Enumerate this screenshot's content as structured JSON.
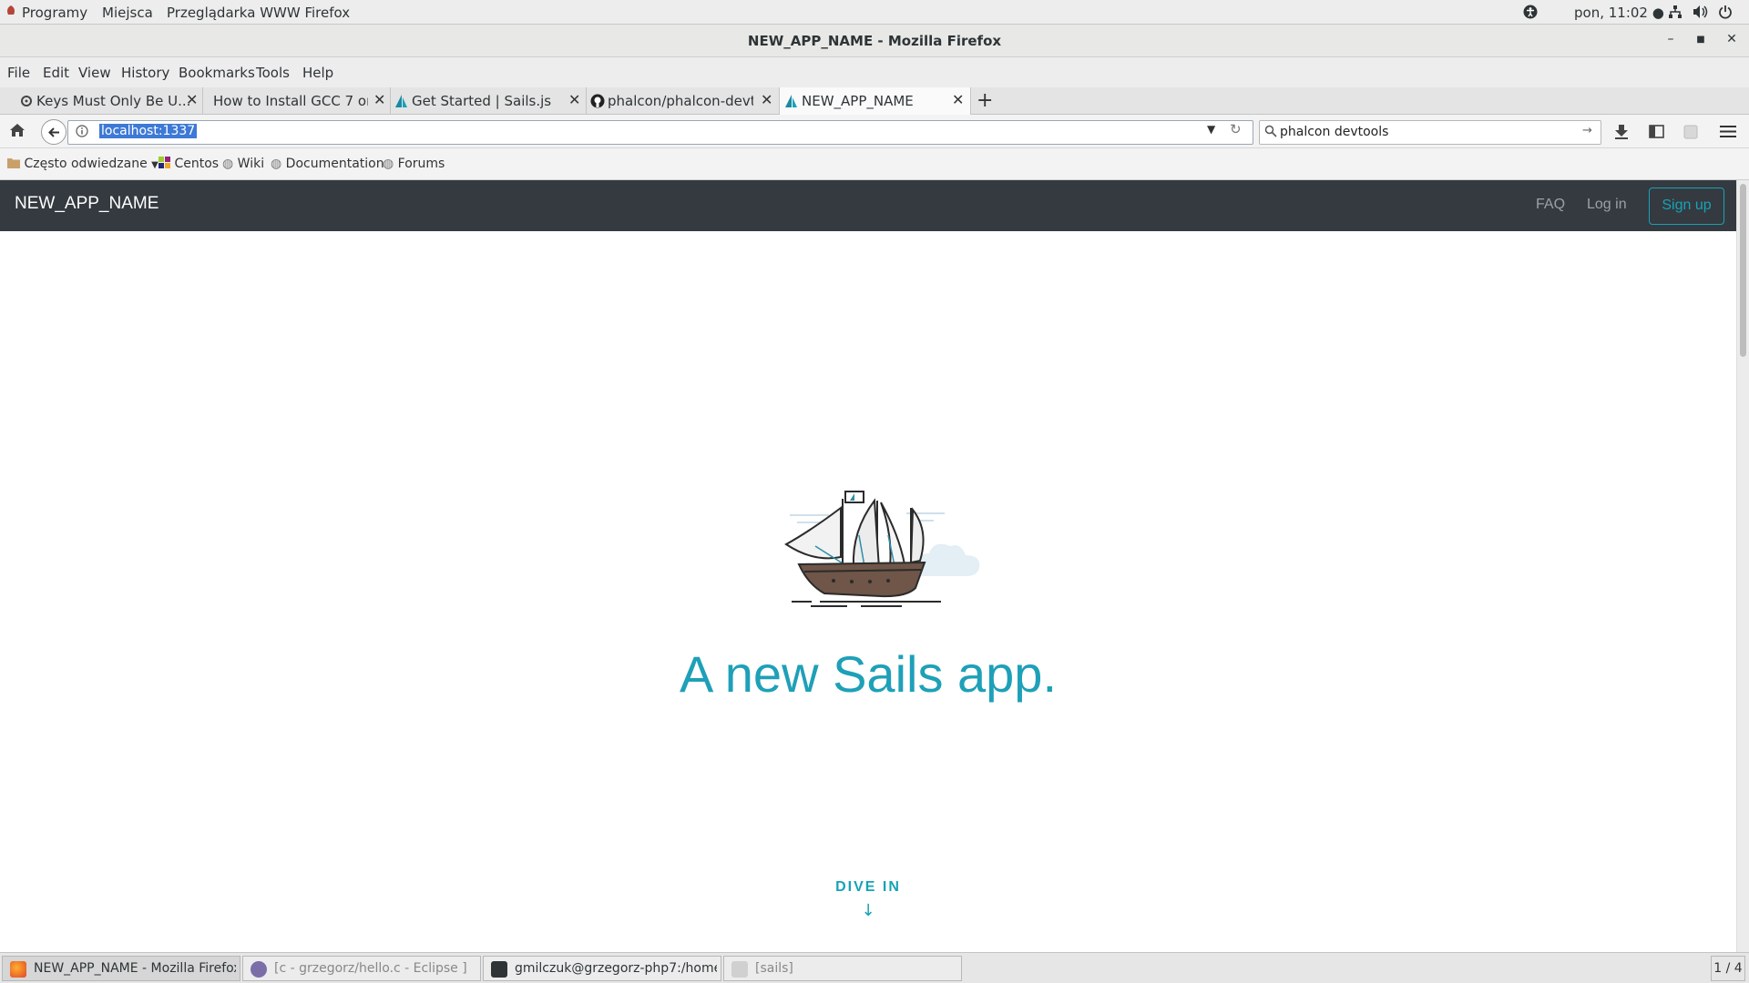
{
  "gnome": {
    "apps": "Programy",
    "places": "Miejsca",
    "browser": "Przeglądarka WWW Firefox",
    "clock": "pon, 11:02 ●"
  },
  "window": {
    "title": "NEW_APP_NAME - Mozilla Firefox"
  },
  "menu": [
    "File",
    "Edit",
    "View",
    "History",
    "Bookmarks",
    "Tools",
    "Help"
  ],
  "tabs": [
    {
      "label": "Keys Must Only Be U..."
    },
    {
      "label": "How to Install GCC 7 on ..."
    },
    {
      "label": "Get Started  | Sails.js"
    },
    {
      "label": "phalcon/phalcon-devt..."
    },
    {
      "label": "NEW_APP_NAME"
    }
  ],
  "nav": {
    "url": "localhost:1337",
    "search": "phalcon devtools"
  },
  "bookmarks": [
    "Często odwiedzane",
    "Centos",
    "Wiki",
    "Documentation",
    "Forums"
  ],
  "site": {
    "brand": "NEW_APP_NAME",
    "faq": "FAQ",
    "login": "Log in",
    "signup": "Sign up",
    "hero": "A new Sails app.",
    "dive": "DIVE IN",
    "dive_arrow": "↓"
  },
  "taskbar": {
    "items": [
      {
        "label": "NEW_APP_NAME - Mozilla Firefox"
      },
      {
        "label": "[c - grzegorz/hello.c - Eclipse ]"
      },
      {
        "label": "gmilczuk@grzegorz-php7:/home/g..."
      },
      {
        "label": "[sails]"
      }
    ],
    "workspace": "1 / 4"
  },
  "colors": {
    "accent": "#17a2b8",
    "site_nav": "#343a40"
  }
}
